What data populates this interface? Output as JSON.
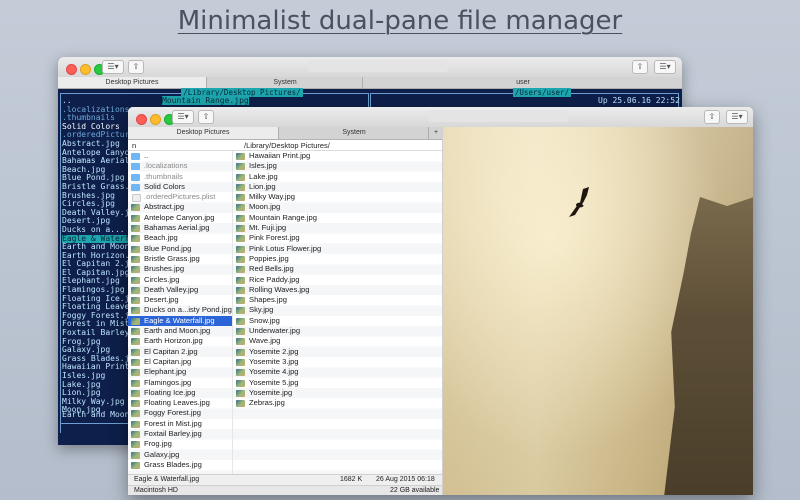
{
  "headline": "Minimalist dual-pane file manager",
  "back_window": {
    "tabs": [
      "Desktop Pictures",
      "System",
      "user"
    ],
    "left_path": "/Library/Desktop Pictures/",
    "left_cursor_name": "Mountain Range.jpg",
    "right_path": "/Users/user/",
    "right_date": "Up 25.06.16 22:52",
    "files": [
      "..",
      ".localizations",
      ".thumbnails",
      "Solid Colors",
      ".orderedPictures.",
      "Abstract.jpg",
      "Antelope Canyon.",
      "Bahamas Aerial.",
      "Beach.jpg",
      "Blue Pond.jpg",
      "Bristle Grass.j",
      "Brushes.jpg",
      "Circles.jpg",
      "Death Valley.jp",
      "Desert.jpg",
      "Ducks on a... P",
      "Eagle & Waterfal",
      "Earth and Moon.",
      "Earth Horizon.j",
      "El Capitan 2.jp",
      "El Capitan.jpg",
      "Elephant.jpg",
      "Flamingos.jpg",
      "Floating Ice.jp",
      "Floating Leaves",
      "Foggy Forest.jp",
      "Forest in Mist.",
      "Foxtail Barley.",
      "Frog.jpg",
      "Galaxy.jpg",
      "Grass Blades.jp",
      "Hawaiian Print.",
      "Isles.jpg",
      "Lake.jpg",
      "Lion.jpg",
      "Milky Way.jpg",
      "Moon.jpg"
    ],
    "bottom_name": "Earth and Moon."
  },
  "front_window": {
    "tabs": [
      "Desktop Pictures",
      "System"
    ],
    "add_tab": "+",
    "path_name": "n",
    "path": "/Library/Desktop Pictures/",
    "col1": [
      {
        "name": "..",
        "icon": "folder"
      },
      {
        "name": ".localizations",
        "icon": "folder",
        "faint": true
      },
      {
        "name": ".thumbnails",
        "icon": "folder",
        "faint": true
      },
      {
        "name": "Solid Colors",
        "icon": "folder"
      },
      {
        "name": ".orderedPictures.plist",
        "icon": "file",
        "faint": true
      },
      {
        "name": "Abstract.jpg",
        "icon": "img"
      },
      {
        "name": "Antelope Canyon.jpg",
        "icon": "img"
      },
      {
        "name": "Bahamas Aerial.jpg",
        "icon": "img"
      },
      {
        "name": "Beach.jpg",
        "icon": "img"
      },
      {
        "name": "Blue Pond.jpg",
        "icon": "img"
      },
      {
        "name": "Bristle Grass.jpg",
        "icon": "img"
      },
      {
        "name": "Brushes.jpg",
        "icon": "img"
      },
      {
        "name": "Circles.jpg",
        "icon": "img"
      },
      {
        "name": "Death Valley.jpg",
        "icon": "img"
      },
      {
        "name": "Desert.jpg",
        "icon": "img"
      },
      {
        "name": "Ducks on a...isty Pond.jpg",
        "icon": "img"
      },
      {
        "name": "Eagle & Waterfall.jpg",
        "icon": "img",
        "selected": true
      },
      {
        "name": "Earth and Moon.jpg",
        "icon": "img"
      },
      {
        "name": "Earth Horizon.jpg",
        "icon": "img"
      },
      {
        "name": "El Capitan 2.jpg",
        "icon": "img"
      },
      {
        "name": "El Capitan.jpg",
        "icon": "img"
      },
      {
        "name": "Elephant.jpg",
        "icon": "img"
      },
      {
        "name": "Flamingos.jpg",
        "icon": "img"
      },
      {
        "name": "Floating Ice.jpg",
        "icon": "img"
      },
      {
        "name": "Floating Leaves.jpg",
        "icon": "img"
      },
      {
        "name": "Foggy Forest.jpg",
        "icon": "img"
      },
      {
        "name": "Forest in Mist.jpg",
        "icon": "img"
      },
      {
        "name": "Foxtail Barley.jpg",
        "icon": "img"
      },
      {
        "name": "Frog.jpg",
        "icon": "img"
      },
      {
        "name": "Galaxy.jpg",
        "icon": "img"
      },
      {
        "name": "Grass Blades.jpg",
        "icon": "img"
      }
    ],
    "col2": [
      {
        "name": "Hawaiian Print.jpg",
        "icon": "img"
      },
      {
        "name": "Isles.jpg",
        "icon": "img"
      },
      {
        "name": "Lake.jpg",
        "icon": "img"
      },
      {
        "name": "Lion.jpg",
        "icon": "img"
      },
      {
        "name": "Milky Way.jpg",
        "icon": "img"
      },
      {
        "name": "Moon.jpg",
        "icon": "img"
      },
      {
        "name": "Mountain Range.jpg",
        "icon": "img"
      },
      {
        "name": "Mt. Fuji.jpg",
        "icon": "img"
      },
      {
        "name": "Pink Forest.jpg",
        "icon": "img"
      },
      {
        "name": "Pink Lotus Flower.jpg",
        "icon": "img"
      },
      {
        "name": "Poppies.jpg",
        "icon": "img"
      },
      {
        "name": "Red Bells.jpg",
        "icon": "img"
      },
      {
        "name": "Rice Paddy.jpg",
        "icon": "img"
      },
      {
        "name": "Rolling Waves.jpg",
        "icon": "img"
      },
      {
        "name": "Shapes.jpg",
        "icon": "img"
      },
      {
        "name": "Sky.jpg",
        "icon": "img"
      },
      {
        "name": "Snow.jpg",
        "icon": "img"
      },
      {
        "name": "Underwater.jpg",
        "icon": "img"
      },
      {
        "name": "Wave.jpg",
        "icon": "img"
      },
      {
        "name": "Yosemite 2.jpg",
        "icon": "img"
      },
      {
        "name": "Yosemite 3.jpg",
        "icon": "img"
      },
      {
        "name": "Yosemite 4.jpg",
        "icon": "img"
      },
      {
        "name": "Yosemite 5.jpg",
        "icon": "img"
      },
      {
        "name": "Yosemite.jpg",
        "icon": "img"
      },
      {
        "name": "Zebras.jpg",
        "icon": "img"
      }
    ],
    "status_name": "Eagle & Waterfall.jpg",
    "status_size": "1682 K",
    "status_date": "26 Aug 2015 06:18",
    "volume": "Macintosh HD",
    "available": "22 GB available"
  }
}
